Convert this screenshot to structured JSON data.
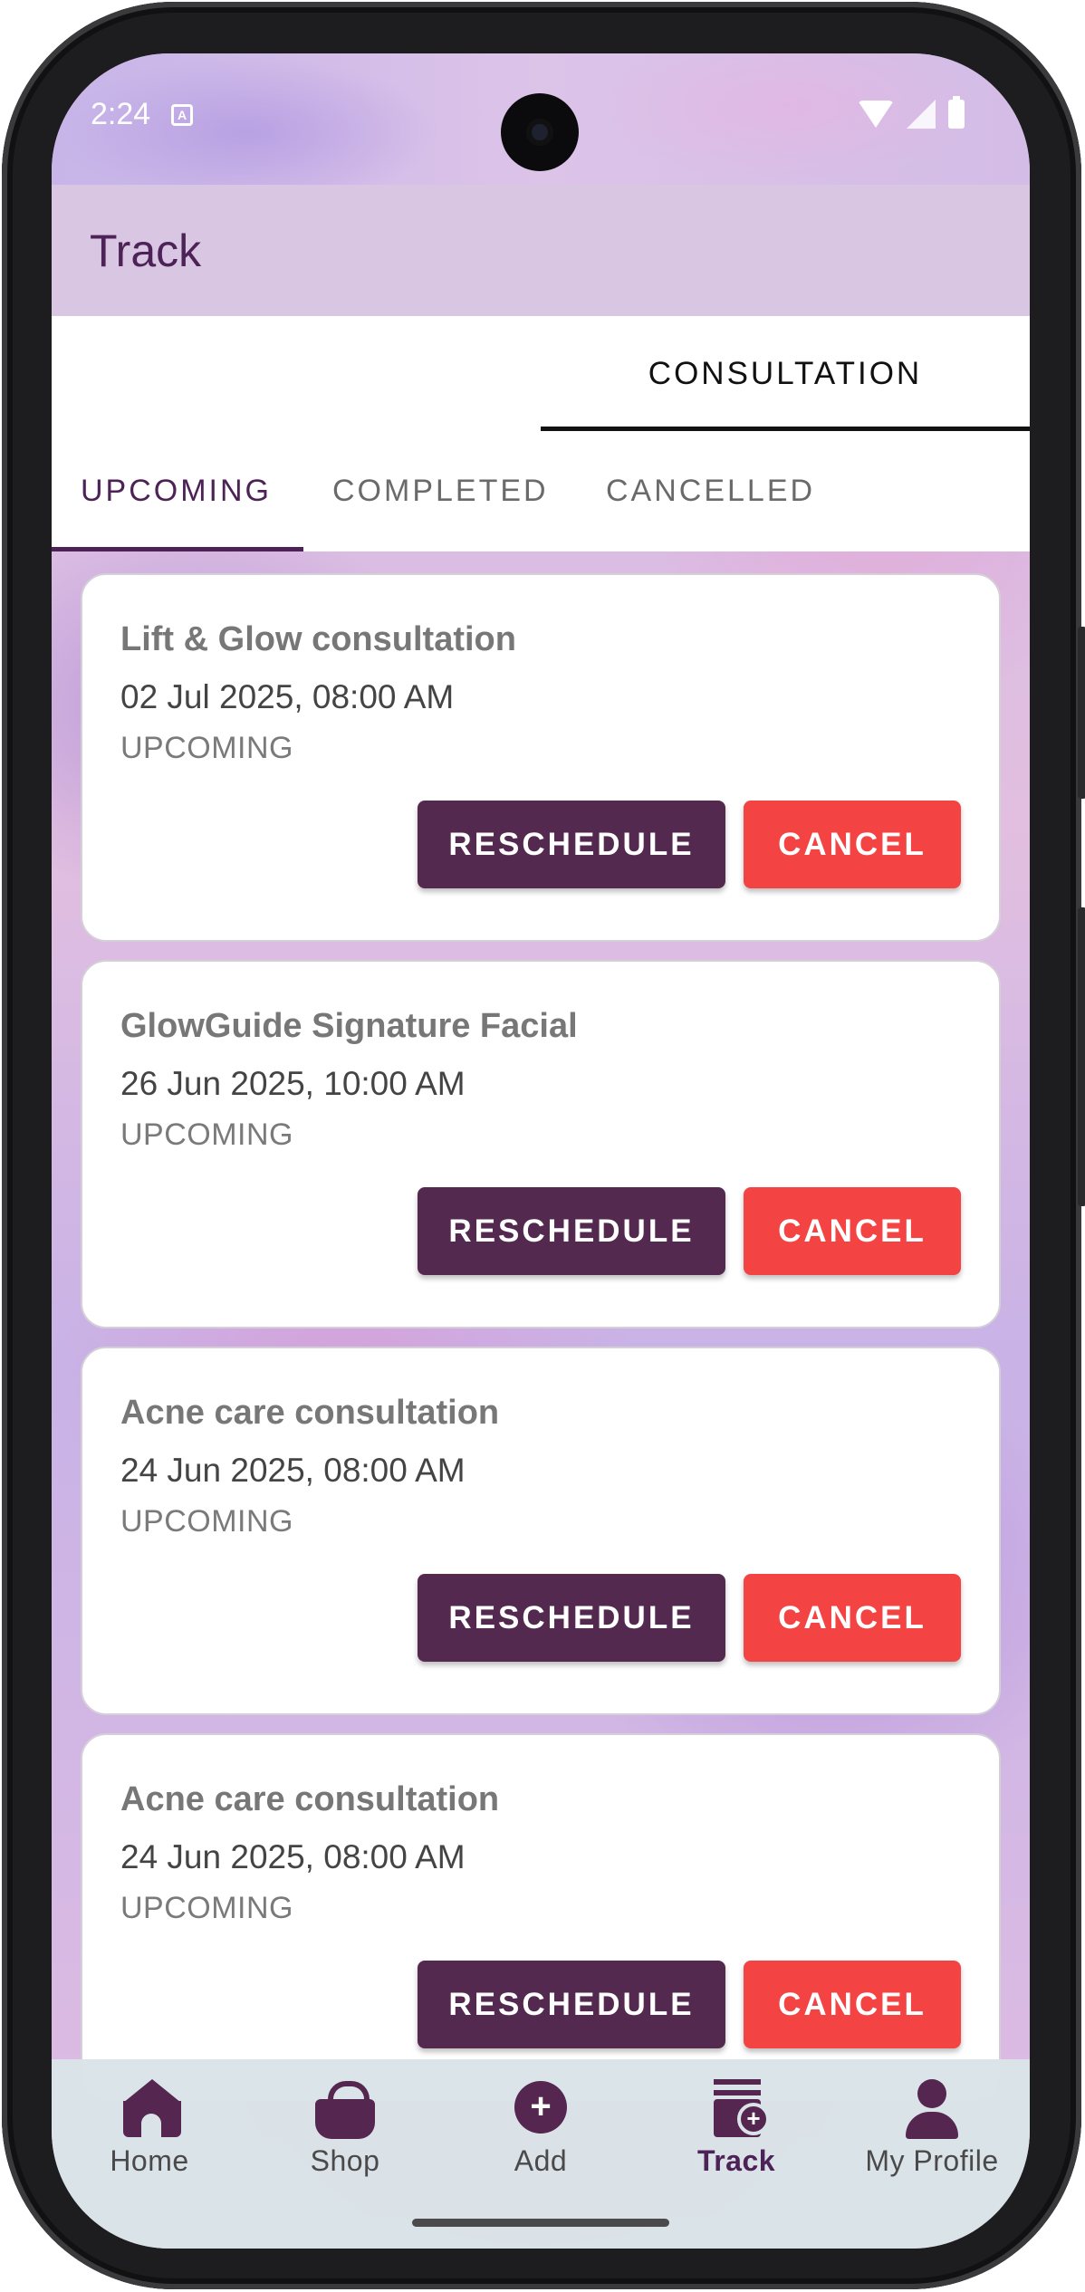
{
  "status_bar": {
    "time": "2:24",
    "notification_icon": "A"
  },
  "app_bar": {
    "title": "Track"
  },
  "primary_tabs": [
    {
      "label": "CONSULTATION",
      "selected": true
    }
  ],
  "sub_tabs": [
    {
      "label": "UPCOMING",
      "selected": true
    },
    {
      "label": "COMPLETED",
      "selected": false
    },
    {
      "label": "CANCELLED",
      "selected": false
    }
  ],
  "appointments": [
    {
      "title": "Lift & Glow consultation",
      "datetime": "02 Jul 2025, 08:00 AM",
      "status": "UPCOMING",
      "reschedule_label": "RESCHEDULE",
      "cancel_label": "CANCEL"
    },
    {
      "title": "GlowGuide Signature Facial",
      "datetime": "26 Jun 2025, 10:00 AM",
      "status": "UPCOMING",
      "reschedule_label": "RESCHEDULE",
      "cancel_label": "CANCEL"
    },
    {
      "title": "Acne care consultation",
      "datetime": "24 Jun 2025, 08:00 AM",
      "status": "UPCOMING",
      "reschedule_label": "RESCHEDULE",
      "cancel_label": "CANCEL"
    },
    {
      "title": "Acne care consultation",
      "datetime": "24 Jun 2025, 08:00 AM",
      "status": "UPCOMING",
      "reschedule_label": "RESCHEDULE",
      "cancel_label": "CANCEL"
    }
  ],
  "bottom_nav": [
    {
      "label": "Home",
      "icon": "home-icon",
      "active": false
    },
    {
      "label": "Shop",
      "icon": "shopping-bag-icon",
      "active": false
    },
    {
      "label": "Add",
      "icon": "add-circle-icon",
      "active": false
    },
    {
      "label": "Track",
      "icon": "track-icon",
      "active": true
    },
    {
      "label": "My Profile",
      "icon": "person-icon",
      "active": false
    }
  ],
  "colors": {
    "primary": "#4d2257",
    "reschedule_button": "#54294f",
    "cancel_button": "#f34343",
    "app_bar": "#d8c6e3",
    "bottom_nav": "#dae4e8"
  }
}
